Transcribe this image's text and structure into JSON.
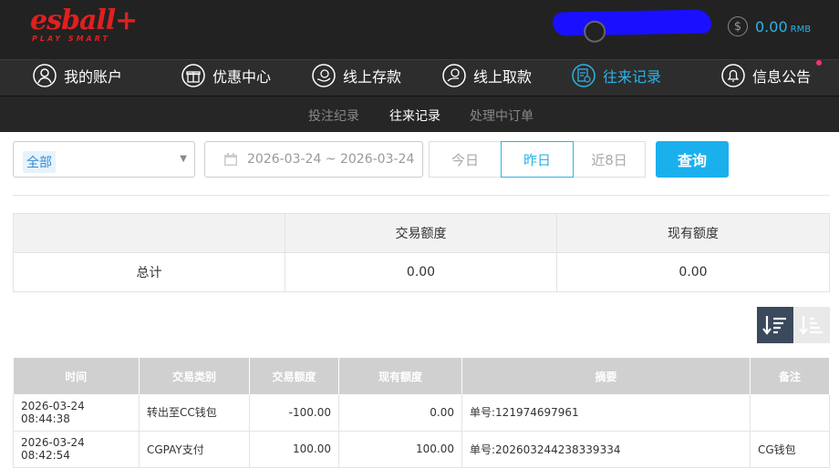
{
  "brand": {
    "name": "esball+",
    "tagline": "PLAY SMART"
  },
  "header": {
    "balance_symbol": "$",
    "balance": "0.00",
    "currency": "RMB"
  },
  "nav": {
    "items": [
      {
        "label": "我的账户",
        "icon": "user-icon"
      },
      {
        "label": "优惠中心",
        "icon": "gift-icon"
      },
      {
        "label": "线上存款",
        "icon": "deposit-icon"
      },
      {
        "label": "线上取款",
        "icon": "withdraw-icon"
      },
      {
        "label": "往来记录",
        "icon": "record-icon",
        "active": true
      },
      {
        "label": "信息公告",
        "icon": "bell-icon"
      }
    ]
  },
  "subnav": {
    "items": [
      "投注纪录",
      "往来记录",
      "处理中订单"
    ],
    "active": "往来记录"
  },
  "filter": {
    "type_selected": "全部",
    "date_range": "2026-03-24 ~ 2026-03-24",
    "quick_dates": [
      "今日",
      "昨日",
      "近8日"
    ],
    "quick_active": "昨日",
    "query_label": "查询"
  },
  "summary": {
    "headers": [
      "",
      "交易额度",
      "现有额度"
    ],
    "row": {
      "label": "总计",
      "transaction": "0.00",
      "balance": "0.00"
    }
  },
  "records": {
    "headers": [
      "时间",
      "交易类别",
      "交易额度",
      "现有额度",
      "摘要",
      "备注"
    ],
    "rows": [
      [
        "2026-03-24 08:44:38",
        "转出至CC钱包",
        "-100.00",
        "0.00",
        "单号:121974697961",
        ""
      ],
      [
        "2026-03-24 08:42:54",
        "CGPAY支付",
        "100.00",
        "100.00",
        "单号:202603244238339334",
        "CG钱包"
      ]
    ]
  },
  "colors": {
    "accent": "#2ab3e8",
    "brand": "#e0201f",
    "topbar": "#222222"
  }
}
